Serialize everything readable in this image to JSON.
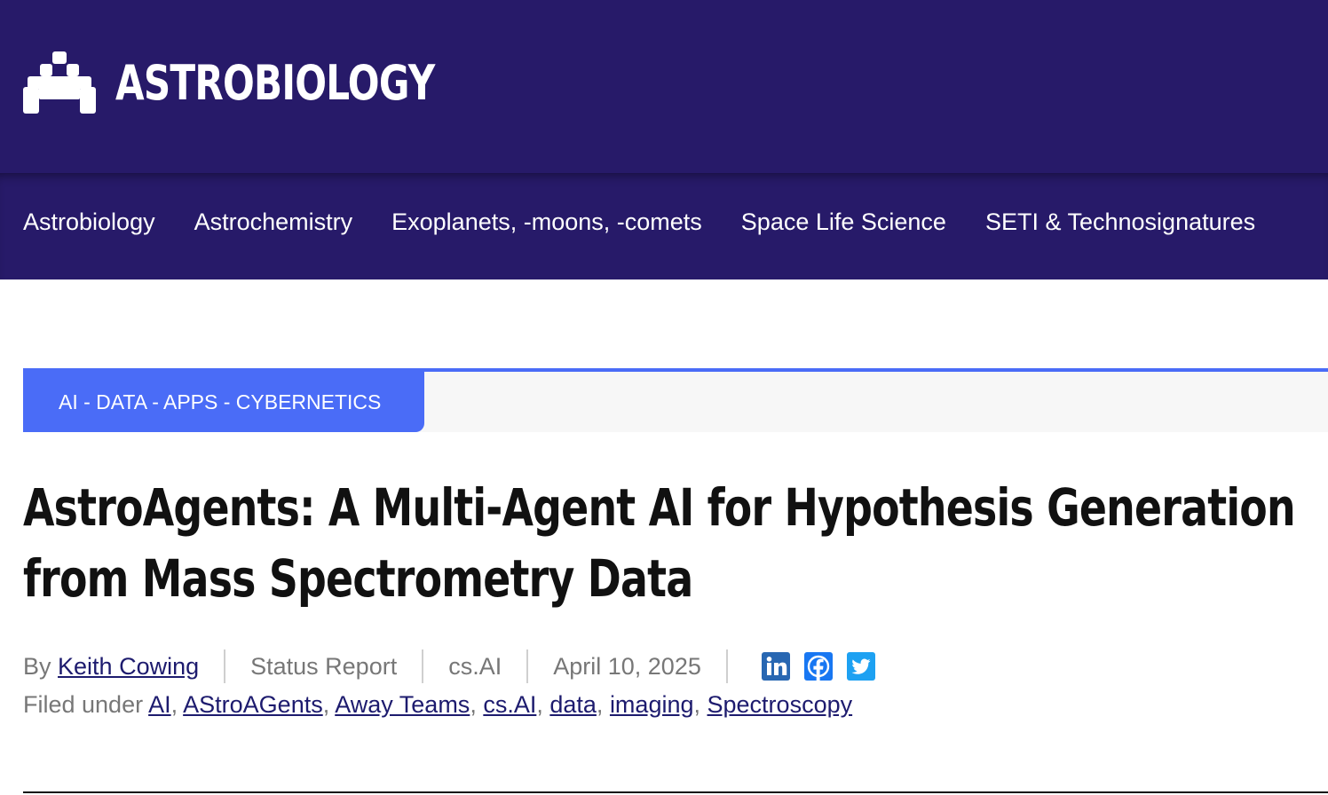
{
  "header": {
    "site_name": "ASTROBIOLOGY",
    "logo_icon": "space-invader-icon",
    "background_color": "#271a69"
  },
  "nav": {
    "items": [
      {
        "label": "Astrobiology"
      },
      {
        "label": "Astrochemistry"
      },
      {
        "label": "Exoplanets, -moons, -comets"
      },
      {
        "label": "Space Life Science"
      },
      {
        "label": "SETI & Technosignatures"
      }
    ]
  },
  "category": {
    "label": "AI - DATA - APPS - CYBERNETICS",
    "accent_color": "#4a6cf7"
  },
  "article": {
    "title": "AstroAgents: A Multi-Agent AI for Hypothesis Generation from Mass Spectrometry Data",
    "by_label": "By",
    "author": "Keith Cowing",
    "type": "Status Report",
    "source": "cs.AI",
    "date": "April 10, 2025",
    "share": [
      {
        "icon": "linkedin-icon",
        "color": "#2867b2"
      },
      {
        "icon": "facebook-icon",
        "color": "#1877f2"
      },
      {
        "icon": "twitter-icon",
        "color": "#1da1f2"
      }
    ],
    "filed_under_label": "Filed under",
    "tags": [
      "AI",
      "AStroAGents",
      "Away Teams",
      "cs.AI",
      "data",
      "imaging",
      "Spectroscopy"
    ]
  }
}
